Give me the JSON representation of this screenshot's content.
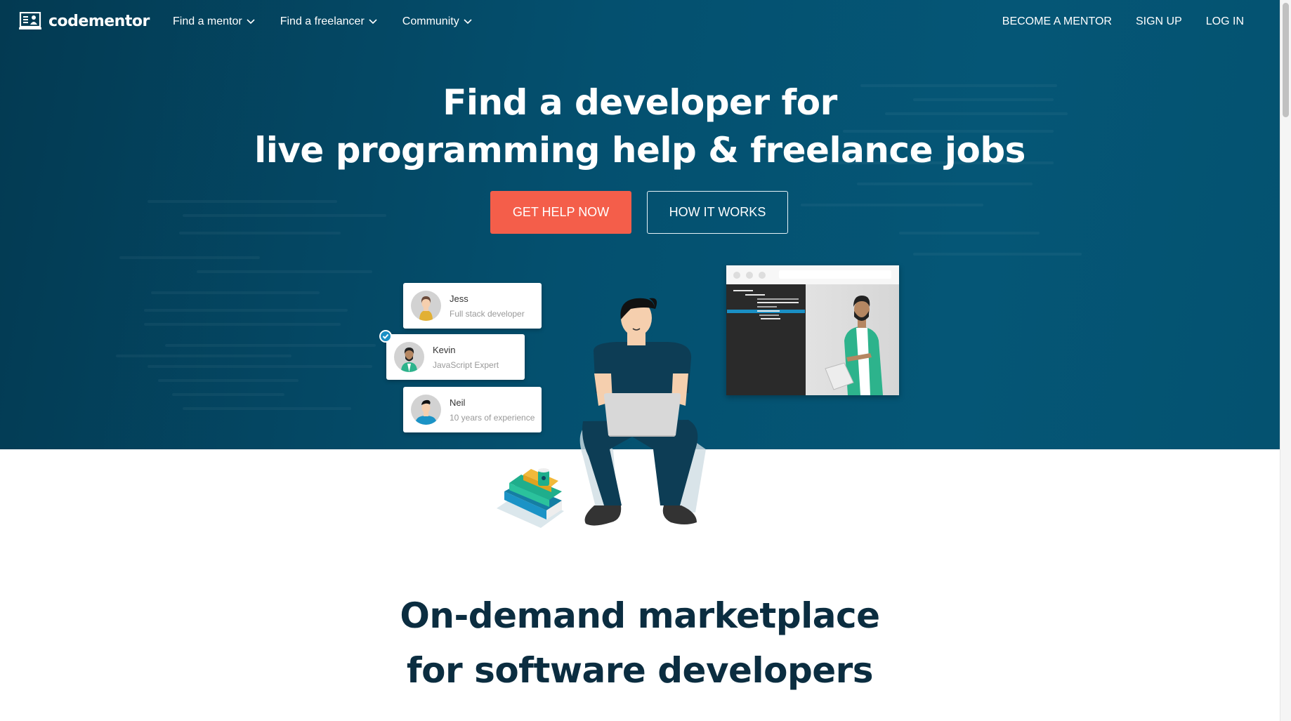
{
  "brand": {
    "name": "codementor",
    "logo_icon": "mentor-board-icon"
  },
  "nav": {
    "left": [
      {
        "label": "Find a mentor",
        "icon": "chevron-down-icon"
      },
      {
        "label": "Find a freelancer",
        "icon": "chevron-down-icon"
      },
      {
        "label": "Community",
        "icon": "chevron-down-icon"
      }
    ],
    "right": [
      {
        "label": "BECOME A MENTOR"
      },
      {
        "label": "SIGN UP"
      },
      {
        "label": "LOG IN"
      }
    ]
  },
  "hero": {
    "headline_line1": "Find a developer for",
    "headline_line2": "live programming help & freelance jobs",
    "primary_button": "GET HELP NOW",
    "secondary_button": "HOW IT WORKS",
    "colors": {
      "background": "#04506f",
      "primary_button": "#f45e4a",
      "selected_check": "#1a8fc4"
    },
    "profiles": [
      {
        "name": "Jess",
        "role": "Full stack developer",
        "selected": false
      },
      {
        "name": "Kevin",
        "role": "JavaScript Expert",
        "selected": true
      },
      {
        "name": "Neil",
        "role": "10 years of experience",
        "selected": false
      }
    ]
  },
  "section": {
    "heading_line1": "On-demand marketplace",
    "heading_line2": "for software developers",
    "heading_color": "#0b2d40"
  }
}
